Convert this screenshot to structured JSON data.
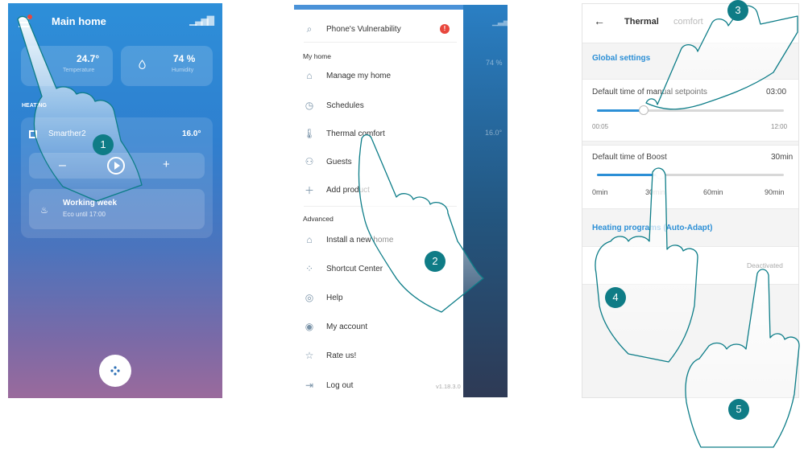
{
  "colors": {
    "badge": "#0f7c86",
    "hand_outline": "#0d7d88",
    "accent": "#2c8fd6",
    "alert": "#e8473d"
  },
  "screen1": {
    "title": "Main home",
    "temperature": {
      "value": "24.7°",
      "label": "Temperature"
    },
    "humidity": {
      "value": "74 %",
      "label": "Humidity"
    },
    "section": "HEATING",
    "thermostat": {
      "name": "Smarther2",
      "temp": "16.0°"
    },
    "controls": {
      "minus": "–",
      "plus": "+"
    },
    "program": {
      "name": "Working week",
      "sub": "Eco until 17:00"
    },
    "icons": [
      "menu-icon",
      "signal-icon",
      "drop-icon",
      "play-icon",
      "flame-icon",
      "apps-icon"
    ]
  },
  "screen2": {
    "top_item": "Phone's Vulnerability",
    "alert": "!",
    "section_home": "My home",
    "home_items": [
      "Manage my home",
      "Schedules",
      "Thermal comfort",
      "Guests",
      "Add product"
    ],
    "section_advanced": "Advanced",
    "advanced_items": [
      "Install a new home",
      "Shortcut Center",
      "Help",
      "My account",
      "Rate us!",
      "Log out"
    ],
    "version": "v1.18.3.0",
    "ghost_humidity": "74 %",
    "ghost_temp": "16.0°"
  },
  "screen3": {
    "title": "Thermal",
    "title_faded": "comfort",
    "global": "Global settings",
    "manual": {
      "label": "Default time of manual setpoints",
      "value": "03:00",
      "min": "00:05",
      "max": "12:00",
      "level": 0.25
    },
    "boost": {
      "label": "Default time of Boost",
      "value": "30min",
      "ticks": [
        "0min",
        "30min",
        "60min",
        "90min"
      ],
      "level": 0.33
    },
    "heating_link": "Heating programs (Auto-Adapt)",
    "deactivated": "Deactivated"
  },
  "badges": [
    "1",
    "2",
    "3",
    "4",
    "5"
  ]
}
